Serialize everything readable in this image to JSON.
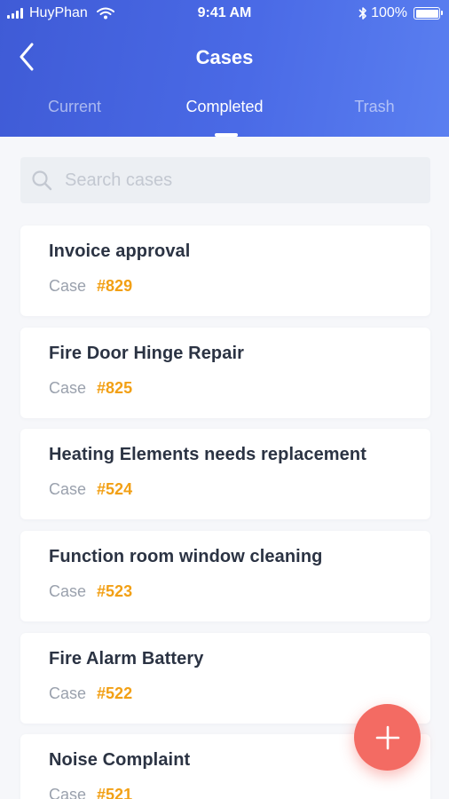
{
  "status_bar": {
    "carrier": "HuyPhan",
    "time": "9:41 AM",
    "battery": "100%"
  },
  "header": {
    "title": "Cases",
    "tabs": [
      {
        "label": "Current"
      },
      {
        "label": "Completed"
      },
      {
        "label": "Trash"
      }
    ],
    "active_tab": "Completed"
  },
  "search": {
    "placeholder": "Search cases",
    "value": ""
  },
  "cases": [
    {
      "title": "Invoice approval",
      "label": "Case",
      "number": "#829"
    },
    {
      "title": "Fire Door Hinge Repair",
      "label": "Case",
      "number": "#825"
    },
    {
      "title": "Heating Elements needs replacement",
      "label": "Case",
      "number": "#524"
    },
    {
      "title": "Function room window cleaning",
      "label": "Case",
      "number": "#523"
    },
    {
      "title": "Fire Alarm Battery",
      "label": "Case",
      "number": "#522"
    },
    {
      "title": "Noise Complaint",
      "label": "Case",
      "number": "#521"
    }
  ],
  "icons": {
    "back": "chevron-left-icon",
    "search": "search-icon",
    "add": "plus-icon"
  },
  "colors": {
    "header_start": "#3f5bd6",
    "header_end": "#5a7ff0",
    "case_number": "#f2a015",
    "fab": "#f36b63"
  }
}
